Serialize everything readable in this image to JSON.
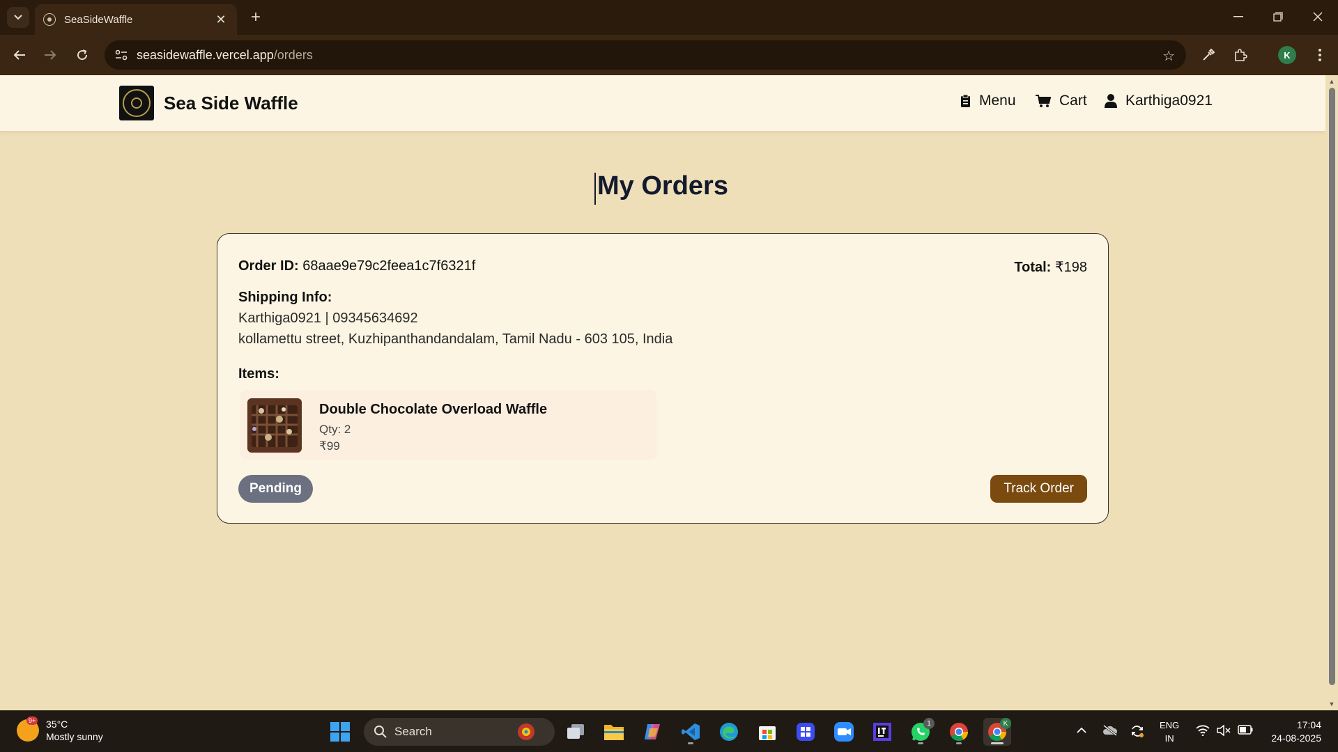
{
  "browser": {
    "tab_title": "SeaSideWaffle",
    "url_host": "seasidewaffle.vercel.app",
    "url_path": "/orders",
    "profile_initial": "K"
  },
  "site": {
    "brand": "Sea Side Waffle",
    "nav": {
      "menu": "Menu",
      "cart": "Cart",
      "user": "Karthiga0921"
    }
  },
  "page": {
    "title": "My Orders"
  },
  "order": {
    "id_label": "Order ID:",
    "id": "68aae9e79c2feea1c7f6321f",
    "total_label": "Total:",
    "total": "₹198",
    "shipping_label": "Shipping Info:",
    "shipping_line1": "Karthiga0921 | 09345634692",
    "shipping_line2": "kollamettu street, Kuzhipanthandandalam, Tamil Nadu - 603 105, India",
    "items_label": "Items:",
    "items": [
      {
        "name": "Double Chocolate Overload Waffle",
        "qty": "Qty: 2",
        "price": "₹99"
      }
    ],
    "status": "Pending",
    "track_label": "Track Order"
  },
  "taskbar": {
    "weather_temp": "35°C",
    "weather_desc": "Mostly sunny",
    "weather_badge": "9+",
    "search_label": "Search",
    "lang_line1": "ENG",
    "lang_line2": "IN",
    "time": "17:04",
    "date": "24-08-2025",
    "whatsapp_badge": "1",
    "chrome_profile_badge": "K"
  },
  "colors": {
    "page_bg": "#efdfb9",
    "header_bg": "#fdf5e3",
    "card_bg": "#fdf5e3",
    "status_pending": "#6b7180",
    "track_button": "#7a4a0f"
  }
}
